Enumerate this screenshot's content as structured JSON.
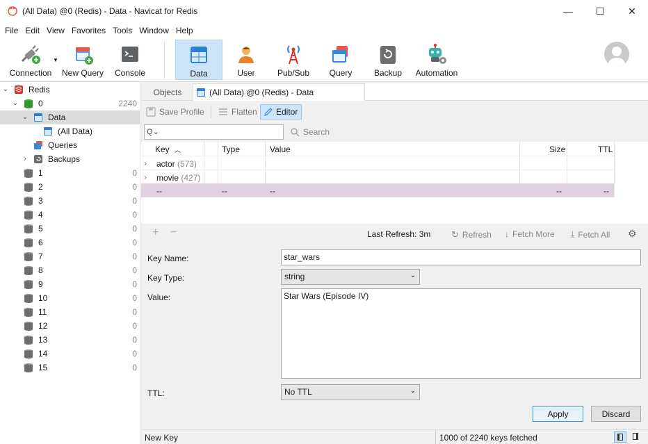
{
  "window": {
    "title": "(All Data) @0 (Redis) - Data - Navicat for Redis",
    "minimize": "—",
    "maximize": "☐",
    "close": "✕"
  },
  "menu": [
    "File",
    "Edit",
    "View",
    "Favorites",
    "Tools",
    "Window",
    "Help"
  ],
  "toolbar": {
    "connection": "Connection",
    "new_query": "New Query",
    "console": "Console",
    "data": "Data",
    "user": "User",
    "pubsub": "Pub/Sub",
    "query": "Query",
    "backup": "Backup",
    "automation": "Automation"
  },
  "sidebar": {
    "root": "Redis",
    "db0": {
      "label": "0",
      "count": "2240"
    },
    "data": "Data",
    "all_data": "(All Data)",
    "queries": "Queries",
    "backups": "Backups",
    "dbs": [
      {
        "label": "1",
        "count": "0"
      },
      {
        "label": "2",
        "count": "0"
      },
      {
        "label": "3",
        "count": "0"
      },
      {
        "label": "4",
        "count": "0"
      },
      {
        "label": "5",
        "count": "0"
      },
      {
        "label": "6",
        "count": "0"
      },
      {
        "label": "7",
        "count": "0"
      },
      {
        "label": "8",
        "count": "0"
      },
      {
        "label": "9",
        "count": "0"
      },
      {
        "label": "10",
        "count": "0"
      },
      {
        "label": "11",
        "count": "0"
      },
      {
        "label": "12",
        "count": "0"
      },
      {
        "label": "13",
        "count": "0"
      },
      {
        "label": "14",
        "count": "0"
      },
      {
        "label": "15",
        "count": "0"
      }
    ]
  },
  "tabs": {
    "objects": "Objects",
    "data_tab": "(All Data) @0 (Redis) - Data"
  },
  "subtoolbar": {
    "save_profile": "Save Profile",
    "flatten": "Flatten",
    "editor": "Editor"
  },
  "search": {
    "icon_label": "Q",
    "placeholder": "",
    "button": "Search"
  },
  "grid": {
    "headers": {
      "key": "Key",
      "type": "Type",
      "value": "Value",
      "size": "Size",
      "ttl": "TTL"
    },
    "rows": [
      {
        "key": "actor",
        "count": "(573)",
        "type": "",
        "value": "",
        "size": "",
        "ttl": ""
      },
      {
        "key": "movie",
        "count": "(427)",
        "type": "",
        "value": "",
        "size": "",
        "ttl": ""
      },
      {
        "key": "--",
        "count": "",
        "type": "--",
        "value": "--",
        "size": "--",
        "ttl": "--"
      }
    ]
  },
  "actionbar": {
    "add": "+",
    "remove": "−",
    "last_refresh": "Last Refresh: 3m",
    "refresh": "Refresh",
    "fetch_more": "Fetch More",
    "fetch_all": "Fetch All"
  },
  "form": {
    "key_name_label": "Key Name:",
    "key_name_value": "star_wars",
    "key_type_label": "Key Type:",
    "key_type_value": "string",
    "value_label": "Value:",
    "value_value": "Star Wars (Episode IV)",
    "ttl_label": "TTL:",
    "ttl_value": "No TTL",
    "apply": "Apply",
    "discard": "Discard"
  },
  "status": {
    "left": "New Key",
    "right": "1000 of 2240 keys fetched"
  },
  "colors": {
    "selected_row": "#e1d0e0",
    "toolbar_active": "#cce4f7",
    "redis_red": "#d9342b",
    "db_gray": "#6d6d6d"
  }
}
